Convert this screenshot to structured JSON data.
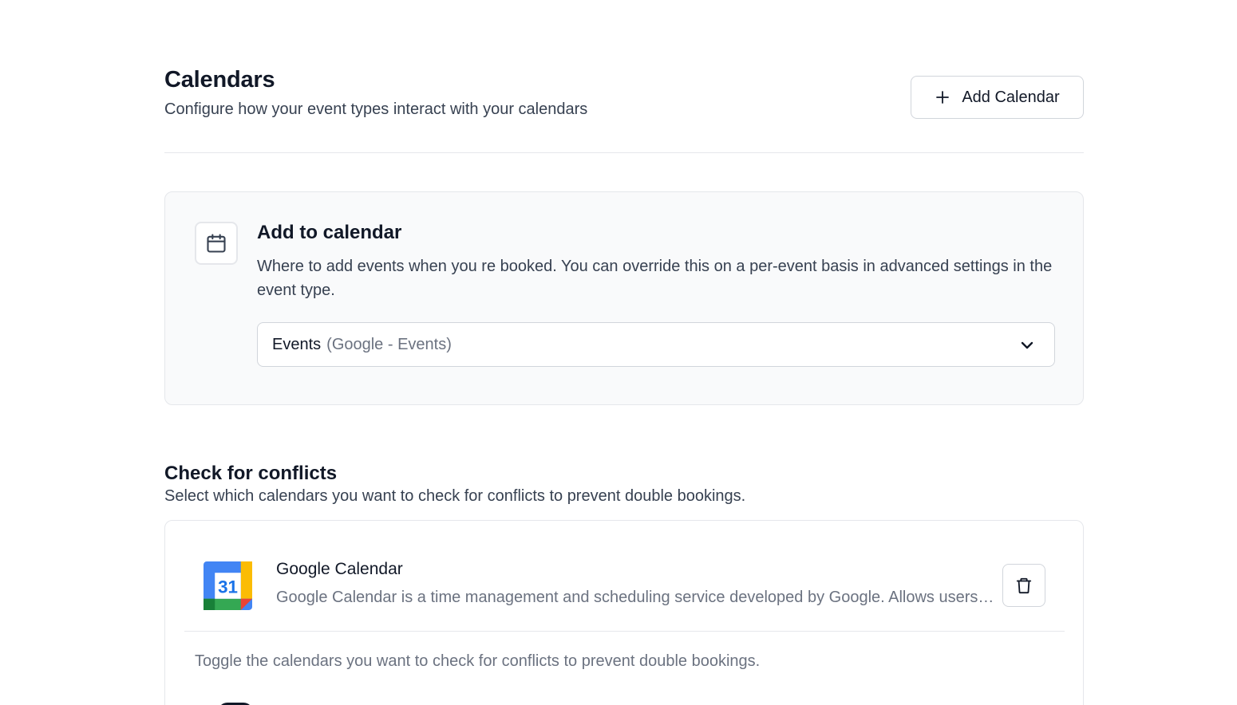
{
  "header": {
    "title": "Calendars",
    "subtitle": "Configure how your event types interact with your calendars",
    "add_button_label": "Add Calendar",
    "add_button_icon": "plus-icon"
  },
  "add_to_calendar": {
    "icon": "calendar-icon",
    "title": "Add to calendar",
    "description": "Where to add events when you re booked. You can override this on a per-event basis in advanced settings in the event type.",
    "selected_value": "Events",
    "selected_detail": "(Google - Events)",
    "dropdown_icon": "chevron-down-icon"
  },
  "conflicts": {
    "title": "Check for conflicts",
    "description": "Select which calendars you want to check for conflicts to prevent double bookings.",
    "integration": {
      "logo": "google-calendar-logo",
      "logo_number": "31",
      "name": "Google Calendar",
      "description": "Google Calendar is a time management and scheduling service developed by Google. Allows users to create and edit events, with options available for type and time.",
      "delete_icon": "trash-icon"
    },
    "toggle_note": "Toggle the calendars you want to check for conflicts to prevent double bookings."
  },
  "colors": {
    "text_primary": "#111827",
    "text_secondary": "#374151",
    "text_muted": "#6b7280",
    "border": "#e5e7eb",
    "card_bg": "#f9fafb"
  }
}
